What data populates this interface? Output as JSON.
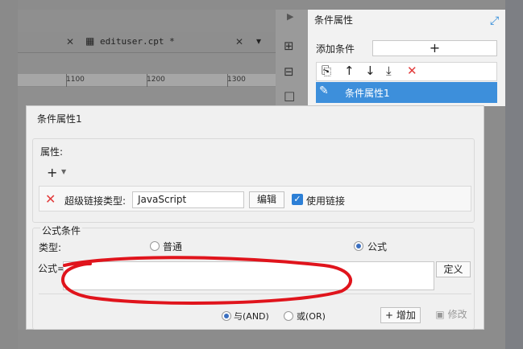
{
  "editor": {
    "tab_title": "edituser.cpt *",
    "ruler_marks": [
      "1100",
      "1200",
      "1300"
    ]
  },
  "condition_panel": {
    "title": "条件属性",
    "add_condition_label": "添加条件",
    "add_button": "+",
    "selected_item": "条件属性1"
  },
  "dialog": {
    "title": "条件属性1",
    "attribute_group": "属性:",
    "hyperlink_type_label": "超级链接类型:",
    "hyperlink_type_value": "JavaScript",
    "edit_button": "编辑",
    "use_link_label": "使用链接",
    "use_link_checked": true,
    "formula_group": "公式条件",
    "type_label": "类型:",
    "type_options": [
      {
        "label": "普通",
        "selected": false
      },
      {
        "label": "公式",
        "selected": true
      }
    ],
    "formula_label": "公式=",
    "formula_value": "",
    "define_button": "定义",
    "logic_options": [
      {
        "label": "与(AND)",
        "selected": true
      },
      {
        "label": "或(OR)",
        "selected": false
      }
    ],
    "add_button": "增加",
    "modify_button": "修改"
  },
  "colors": {
    "accent": "#3d8fdb",
    "delete_red": "#e23b3b",
    "annotation_red": "#e0141c"
  }
}
